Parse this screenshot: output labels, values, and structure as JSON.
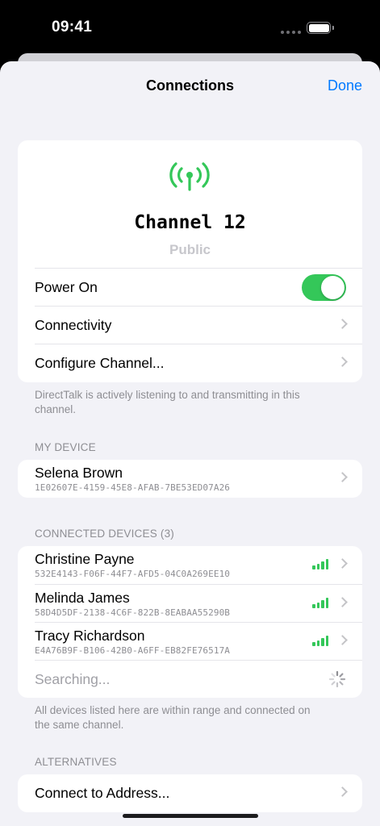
{
  "status": {
    "time": "09:41"
  },
  "nav": {
    "title": "Connections",
    "done_label": "Done"
  },
  "channel": {
    "name": "Channel 12",
    "type": "Public",
    "power_label": "Power On",
    "power_on": true,
    "connectivity_label": "Connectivity",
    "configure_label": "Configure Channel...",
    "footer": "DirectTalk is actively listening to and transmitting in this channel."
  },
  "my_device": {
    "header": "MY DEVICE",
    "name": "Selena Brown",
    "id": "1E02607E-4159-45E8-AFAB-7BE53ED07A26"
  },
  "connected": {
    "header": "CONNECTED DEVICES (3)",
    "devices": [
      {
        "name": "Christine Payne",
        "id": "532E4143-F06F-44F7-AFD5-04C0A269EE10",
        "signal": "signal-icon"
      },
      {
        "name": "Melinda James",
        "id": "58D4D5DF-2138-4C6F-822B-8EABAA55290B",
        "signal": "signal-icon"
      },
      {
        "name": "Tracy Richardson",
        "id": "E4A76B9F-B106-42B0-A6FF-EB82FE76517A",
        "signal": "signal-icon"
      }
    ],
    "searching_label": "Searching...",
    "footer": "All devices listed here are within range and connected on the same channel."
  },
  "alternatives": {
    "header": "ALTERNATIVES",
    "connect_label": "Connect to Address..."
  },
  "colors": {
    "accent": "#007aff",
    "green": "#34c759",
    "background": "#f2f2f7",
    "secondary": "#8e8e93"
  }
}
